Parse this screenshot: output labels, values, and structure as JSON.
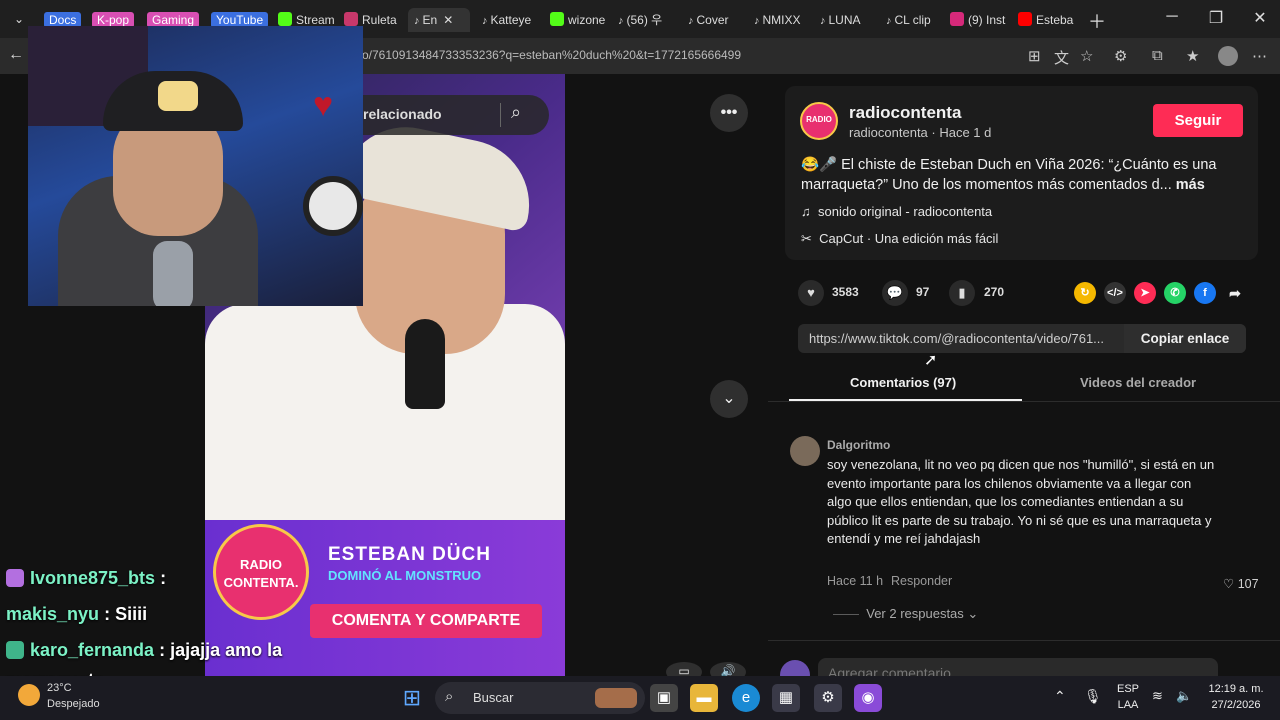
{
  "browser": {
    "tab_groups": [
      {
        "label": "Docs",
        "color": "#3b6fe0"
      },
      {
        "label": "K-pop",
        "color": "#d94fb3"
      },
      {
        "label": "Gaming",
        "color": "#d94fb3"
      },
      {
        "label": "YouTube",
        "color": "#3b6fe0"
      }
    ],
    "tabs": [
      {
        "label": "Stream",
        "icon": "kick-icon"
      },
      {
        "label": "Ruleta",
        "icon": "ruleta-icon"
      },
      {
        "label": "En",
        "icon": "tiktok-icon",
        "active": true
      },
      {
        "label": "Katteye",
        "icon": "tiktok-icon"
      },
      {
        "label": "wizone",
        "icon": "kick-icon"
      },
      {
        "label": "(56) 우",
        "icon": "tiktok-icon"
      },
      {
        "label": "Cover",
        "icon": "tiktok-icon"
      },
      {
        "label": "NMIXX",
        "icon": "tiktok-icon"
      },
      {
        "label": "LUNA",
        "icon": "tiktok-icon"
      },
      {
        "label": "CL clip",
        "icon": "tiktok-icon"
      },
      {
        "label": "(9) Inst",
        "icon": "instagram-icon"
      },
      {
        "label": "Esteba",
        "icon": "youtube-icon"
      }
    ],
    "url": "o/7610913484733353236?q=esteban%20duch%20&t=1772165666499"
  },
  "video": {
    "search_label": "relacionado",
    "overlay_title": "ESTEBAN DÜCH",
    "overlay_subtitle": "DOMINÓ AL MONSTRUO",
    "overlay_cta": "COMENTA Y COMPARTE",
    "logo_line1": "RADIO",
    "logo_line2": "CONTENTA."
  },
  "chat": [
    {
      "user": "Ivonne875_bts",
      "text": ":",
      "user_color": "#7cf2c6"
    },
    {
      "user": "makis_nyu",
      "text": ": Siiii",
      "user_color": "#7cf2c6"
    },
    {
      "user": "karo_fernanda",
      "text": ": jajajja amo la",
      "user_color": "#7cf2c6"
    },
    {
      "user": "",
      "text": "marraqueta",
      "user_color": "#7cf2c6"
    }
  ],
  "post": {
    "channel": "radiocontenta",
    "meta": "radiocontenta · Hace 1 d",
    "follow_label": "Seguir",
    "description": "😂🎤 El chiste de Esteban Duch en Viña 2026: “¿Cuánto es una marraqueta?” Uno de los momentos más comentados d...",
    "more_label": "más",
    "sound": "sonido original - radiocontenta",
    "capcut": "CapCut · Una edición más fácil",
    "likes": "3583",
    "comments": "97",
    "saves": "270",
    "link": "https://www.tiktok.com/@radiocontenta/video/761...",
    "copy_label": "Copiar enlace",
    "tab_comments": "Comentarios (97)",
    "tab_creator": "Videos del creador",
    "accent": "#fe2c55"
  },
  "comment": {
    "user": "Dalgoritmo",
    "text": "soy venezolana, lit no veo pq dicen que nos \"humilló\", si está en un evento importante para los chilenos obviamente va a llegar con algo que ellos entiendan, que los comediantes entiendan a su público lit es parte de su trabajo. Yo ni sé que es una marraqueta y entendí y me reí jahdajash",
    "time": "Hace 11 h",
    "reply_label": "Responder",
    "likes": "107",
    "replies_label": "Ver 2 respuestas",
    "input_placeholder": "Agregar comentario..."
  },
  "taskbar": {
    "weather_temp": "23°C",
    "weather_label": "Despejado",
    "search_label": "Buscar",
    "lang_1": "ESP",
    "lang_2": "LAA",
    "time": "12:19 a. m.",
    "date": "27/2/2026"
  }
}
